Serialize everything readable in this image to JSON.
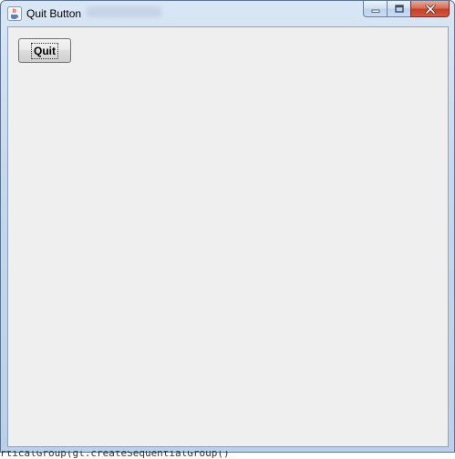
{
  "window": {
    "title": "Quit Button",
    "icon": "java-cup-icon"
  },
  "caption_buttons": {
    "minimize": "minimize-icon",
    "maximize": "maximize-icon",
    "close": "close-icon"
  },
  "content": {
    "quit_label": "Quit"
  },
  "background_code": {
    "text": "rticalGroup(gl.createSequentialGroup()"
  }
}
